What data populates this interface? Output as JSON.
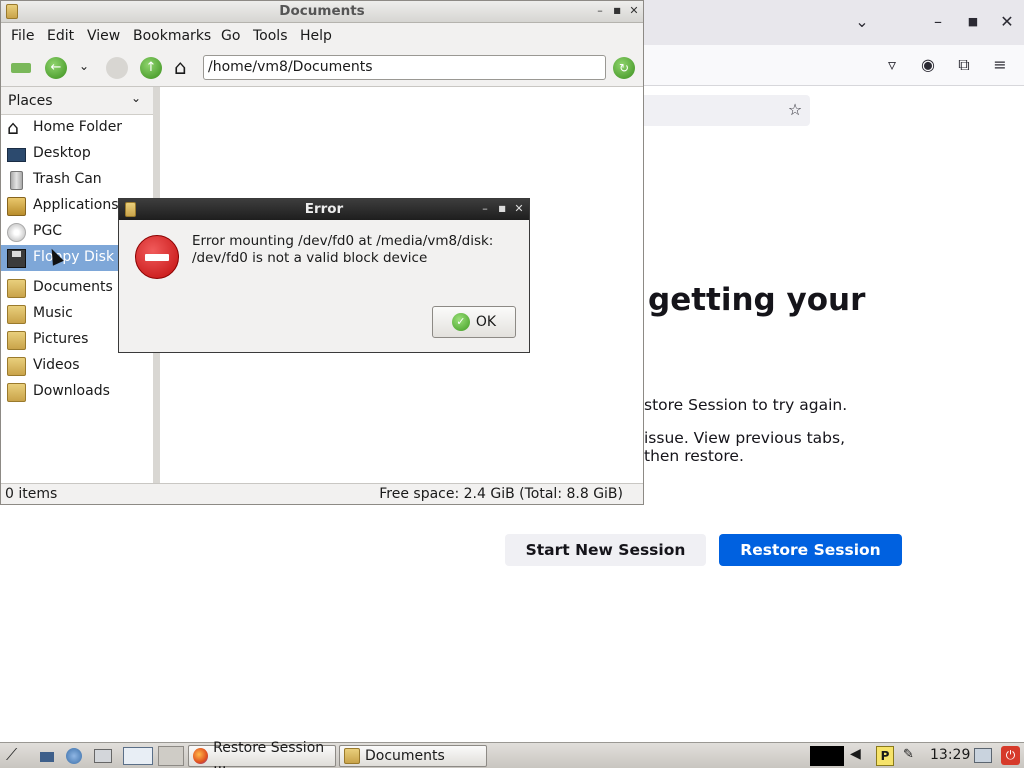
{
  "firefox": {
    "heading": "getting your",
    "paragraph_1": "store Session to try again.",
    "paragraph_2_line_1": "issue. View previous tabs,",
    "paragraph_2_line_2": "then restore.",
    "start_new_session_label": "Start New Session",
    "restore_session_label": "Restore Session",
    "accent_color": "#0061e0"
  },
  "file_manager": {
    "title": "Documents",
    "menu": [
      "File",
      "Edit",
      "View",
      "Bookmarks",
      "Go",
      "Tools",
      "Help"
    ],
    "path": "/home/vm8/Documents",
    "sidebar_header": "Places",
    "places": [
      {
        "label": "Home Folder",
        "icon": "home-icon"
      },
      {
        "label": "Desktop",
        "icon": "desktop-icon"
      },
      {
        "label": "Trash Can",
        "icon": "trash-icon"
      },
      {
        "label": "Applications",
        "icon": "applications-icon"
      },
      {
        "label": "PGC",
        "icon": "drive-icon"
      },
      {
        "label": "Floppy Disk",
        "icon": "floppy-icon",
        "selected": true
      },
      {
        "label": "Documents",
        "icon": "folder-icon"
      },
      {
        "label": "Music",
        "icon": "folder-icon"
      },
      {
        "label": "Pictures",
        "icon": "folder-icon"
      },
      {
        "label": "Videos",
        "icon": "folder-icon"
      },
      {
        "label": "Downloads",
        "icon": "folder-icon"
      }
    ],
    "status_items": "0 items",
    "status_free": "Free space: 2.4 GiB (Total: 8.8 GiB)"
  },
  "error_dialog": {
    "title": "Error",
    "message": "Error mounting /dev/fd0 at /media/vm8/disk: /dev/fd0 is not a valid block device",
    "ok_label": "OK"
  },
  "taskbar": {
    "tasks": [
      "Restore Session ...",
      "Documents"
    ],
    "clock": "13:29"
  }
}
